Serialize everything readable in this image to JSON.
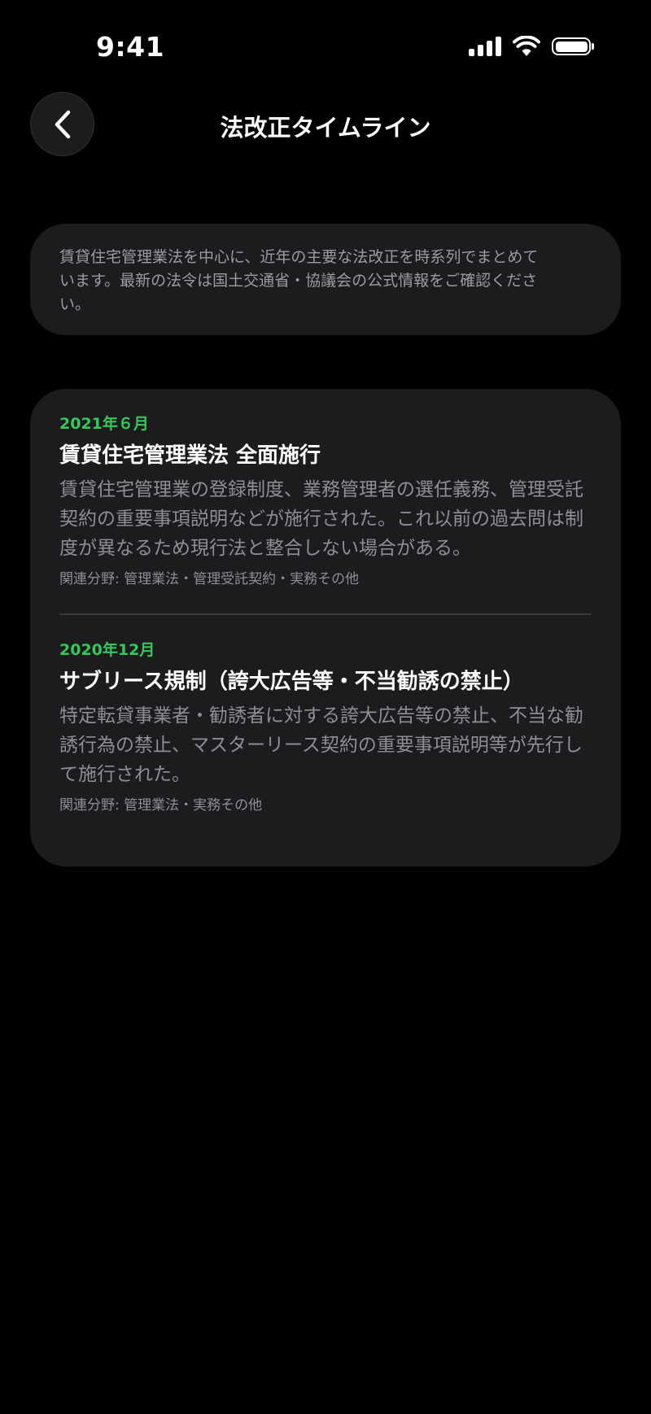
{
  "status_bar": {
    "time": "9:41"
  },
  "nav": {
    "title": "法改正タイムライン",
    "back_icon": "chevron-left-icon"
  },
  "intro": {
    "text": "賃貸住宅管理業法を中心に、近年の主要な法改正を時系列でまとめています。最新の法令は国土交通省・協議会の公式情報をご確認ください。"
  },
  "timeline": [
    {
      "date": "2021年６月",
      "title": "賃貸住宅管理業法 全面施行",
      "description": "賃貸住宅管理業の登録制度、業務管理者の選任義務、管理受託契約の重要事項説明などが施行された。これ以前の過去問は制度が異なるため現行法と整合しない場合がある。",
      "tags": "関連分野: 管理業法・管理受託契約・実務その他"
    },
    {
      "date": "2020年12月",
      "title": "サブリース規制（誇大広告等・不当勧誘の禁止）",
      "description": "特定転貸事業者・勧誘者に対する誇大広告等の禁止、不当な勧誘行為の禁止、マスターリース契約の重要事項説明等が先行して施行された。",
      "tags": "関連分野: 管理業法・実務その他"
    }
  ],
  "colors": {
    "background": "#000000",
    "card": "#1c1c1e",
    "accent_green": "#34c759",
    "secondary_text": "#8e8e93"
  }
}
